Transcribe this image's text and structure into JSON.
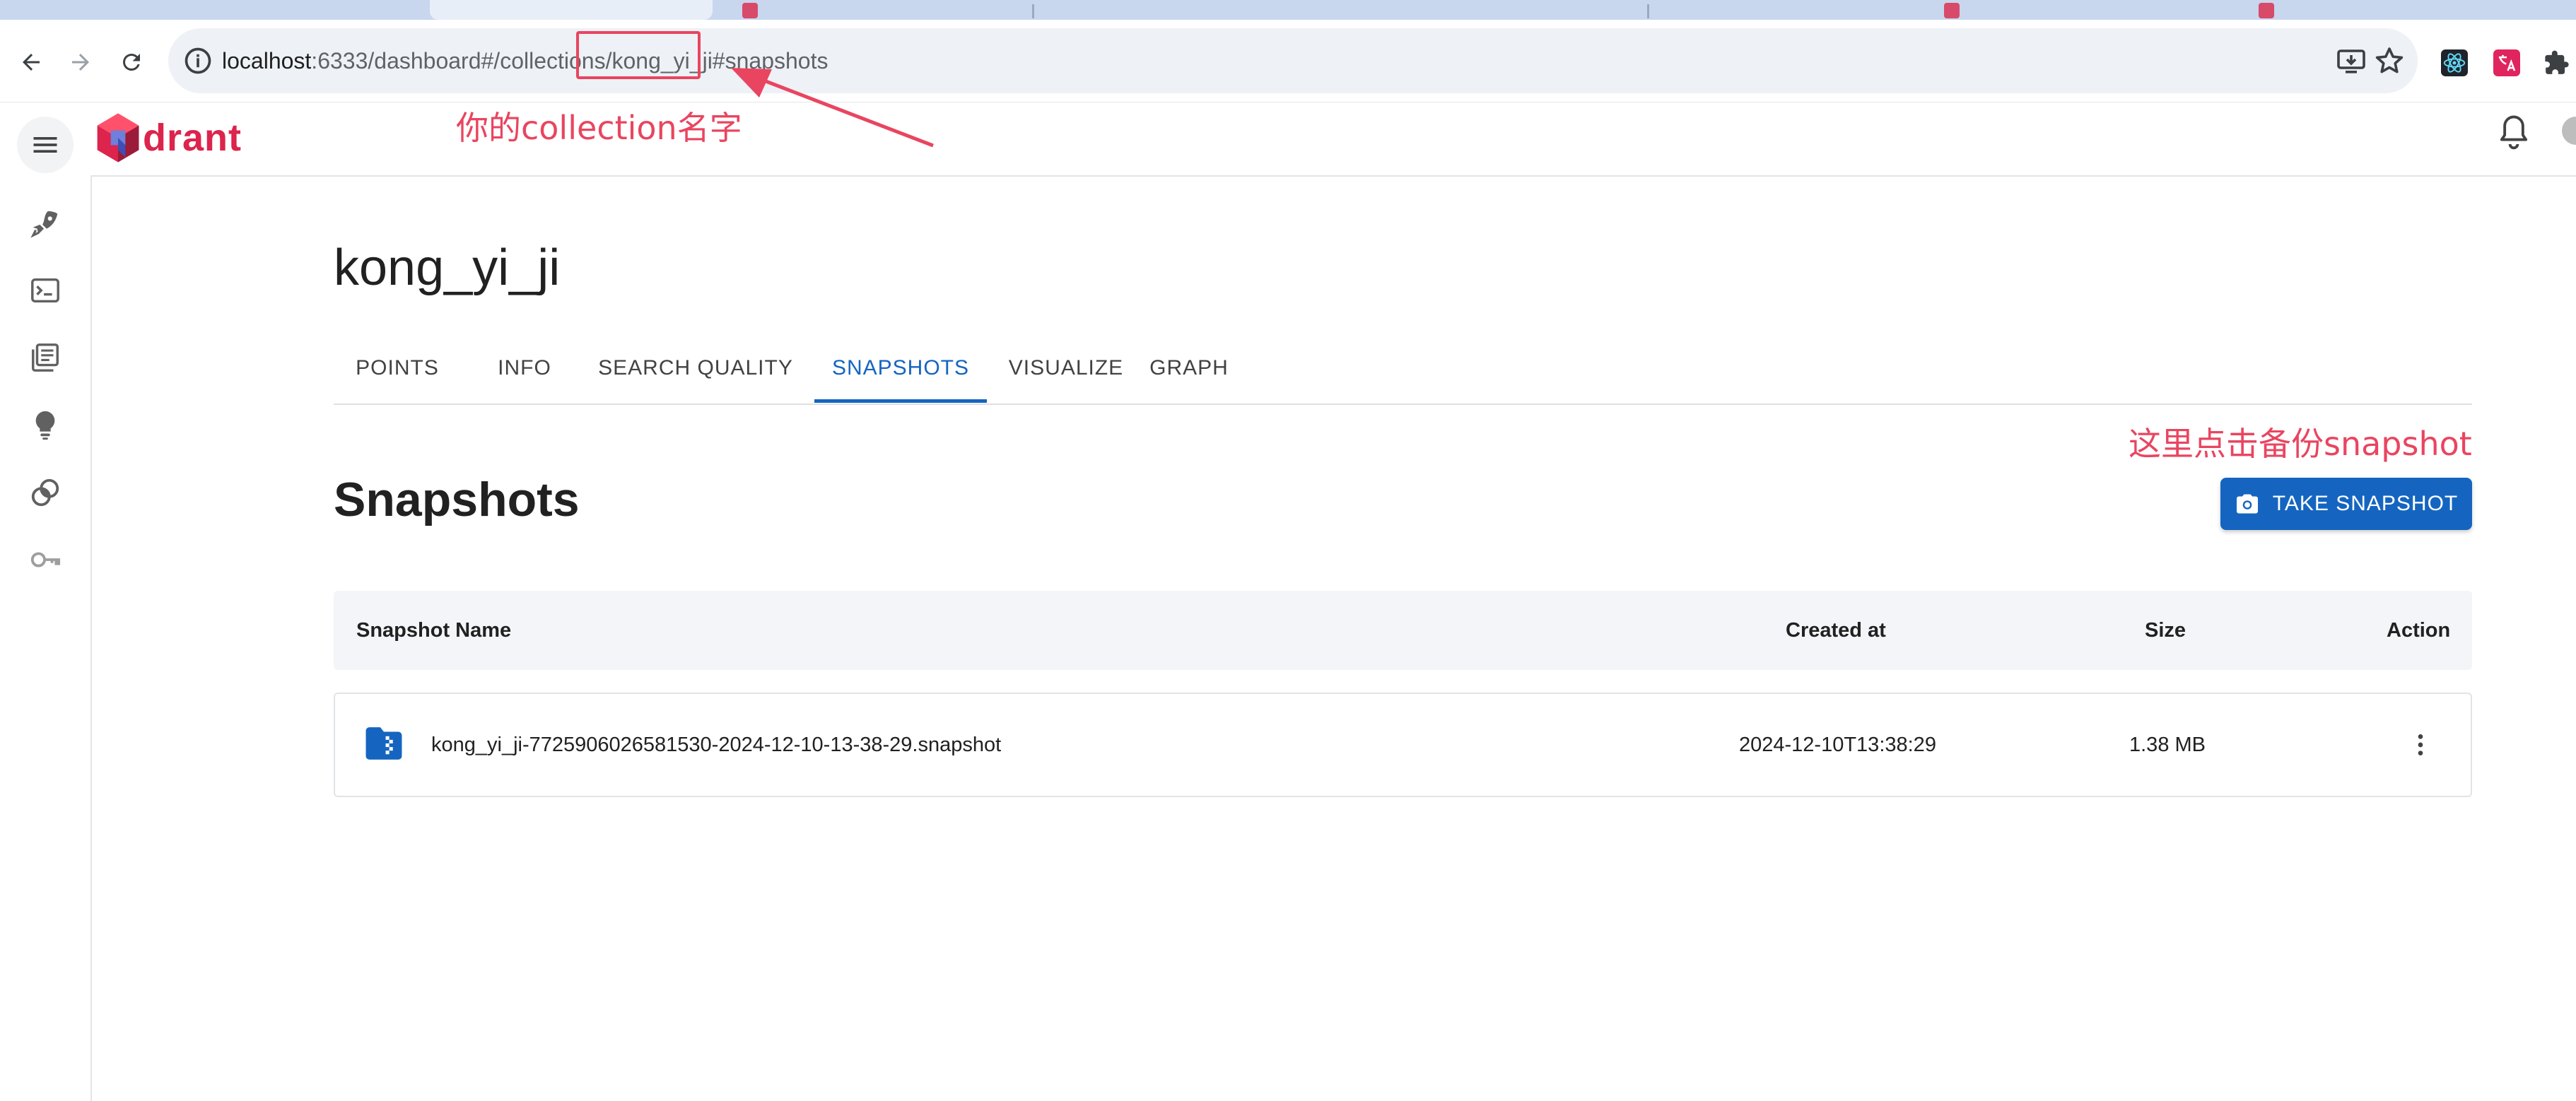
{
  "browser": {
    "url_host": "localhost",
    "url_rest": ":6333/dashboard#/collections/kong_yi_ji#snapshots"
  },
  "app": {
    "logo_text": "drant"
  },
  "collection": {
    "title": "kong_yi_ji"
  },
  "tabs": [
    {
      "label": "POINTS",
      "active": false
    },
    {
      "label": "INFO",
      "active": false
    },
    {
      "label": "SEARCH QUALITY",
      "active": false
    },
    {
      "label": "SNAPSHOTS",
      "active": true
    },
    {
      "label": "VISUALIZE",
      "active": false
    },
    {
      "label": "GRAPH",
      "active": false
    }
  ],
  "snapshots": {
    "heading": "Snapshots",
    "take_button": "TAKE SNAPSHOT",
    "columns": {
      "name": "Snapshot Name",
      "created": "Created at",
      "size": "Size",
      "action": "Action"
    },
    "rows": [
      {
        "name": "kong_yi_ji-7725906026581530-2024-12-10-13-38-29.snapshot",
        "created": "2024-12-10T13:38:29",
        "size": "1.38 MB"
      }
    ]
  },
  "annotations": {
    "collection_note": "你的collection名字",
    "snapshot_note": "这里点击备份snapshot"
  },
  "colors": {
    "accent": "#1565c0",
    "brand": "#dc244c",
    "annotation": "#e94560"
  }
}
